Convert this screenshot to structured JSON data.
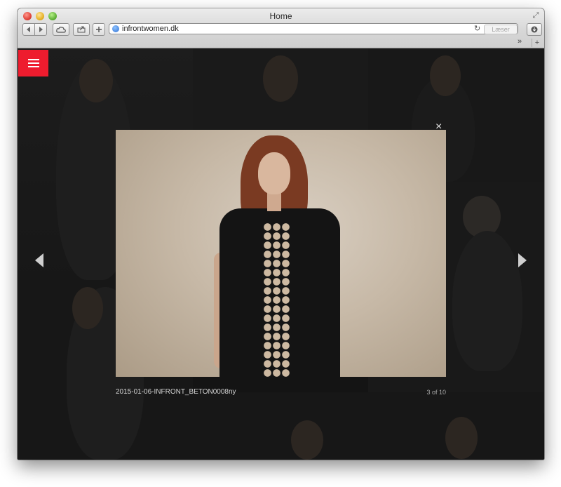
{
  "browser": {
    "window_title": "Home",
    "url": "infrontwomen.dk",
    "reader_label": "Læser",
    "overflow_label": "»",
    "new_tab_label": "+"
  },
  "page": {
    "menu_icon": "hamburger-icon",
    "lightbox": {
      "caption": "2015-01-06-INFRONT_BETON0008ny",
      "counter": "3 of 10",
      "close_label": "×"
    },
    "colors": {
      "menu_accent": "#ee1c2e",
      "overlay_background": "#1d1d1d"
    }
  }
}
